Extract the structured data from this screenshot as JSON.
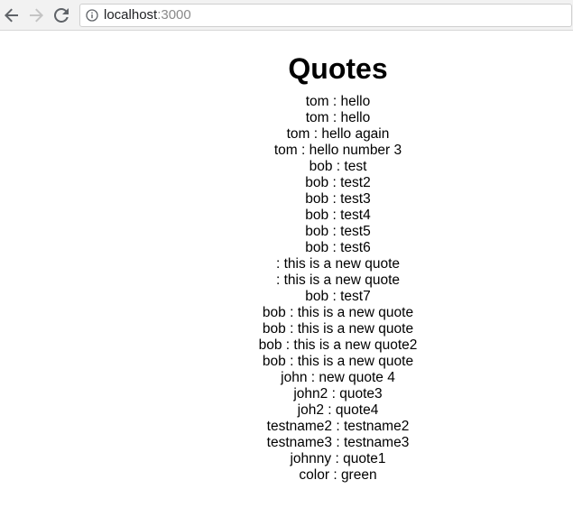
{
  "browser": {
    "url_host": "localhost",
    "url_port": ":3000"
  },
  "page": {
    "title": "Quotes"
  },
  "quotes": [
    {
      "name": "tom",
      "quote": "hello"
    },
    {
      "name": "tom",
      "quote": "hello"
    },
    {
      "name": "tom",
      "quote": "hello again"
    },
    {
      "name": "tom",
      "quote": "hello number 3"
    },
    {
      "name": "bob",
      "quote": "test"
    },
    {
      "name": "bob",
      "quote": "test2"
    },
    {
      "name": "bob",
      "quote": "test3"
    },
    {
      "name": "bob",
      "quote": "test4"
    },
    {
      "name": "bob",
      "quote": "test5"
    },
    {
      "name": "bob",
      "quote": "test6"
    },
    {
      "name": "",
      "quote": "this is a new quote"
    },
    {
      "name": "",
      "quote": "this is a new quote"
    },
    {
      "name": "bob",
      "quote": "test7"
    },
    {
      "name": "bob",
      "quote": "this is a new quote"
    },
    {
      "name": "bob",
      "quote": "this is a new quote"
    },
    {
      "name": "bob",
      "quote": "this is a new quote2"
    },
    {
      "name": "bob",
      "quote": "this is a new quote"
    },
    {
      "name": "john",
      "quote": "new quote 4"
    },
    {
      "name": "john2",
      "quote": "quote3"
    },
    {
      "name": "joh2",
      "quote": "quote4"
    },
    {
      "name": "testname2",
      "quote": "testname2"
    },
    {
      "name": "testname3",
      "quote": "testname3"
    },
    {
      "name": "johnny",
      "quote": "quote1"
    },
    {
      "name": "color",
      "quote": "green"
    }
  ],
  "icons": {
    "back": "arrow-left-icon",
    "forward": "arrow-right-icon",
    "reload": "reload-icon",
    "info": "info-icon"
  },
  "colors": {
    "toolbar_bg": "#f2f2f2",
    "nav_active": "#5f6368",
    "nav_disabled": "#c4c4c4",
    "port_text": "#8a8a8a"
  }
}
